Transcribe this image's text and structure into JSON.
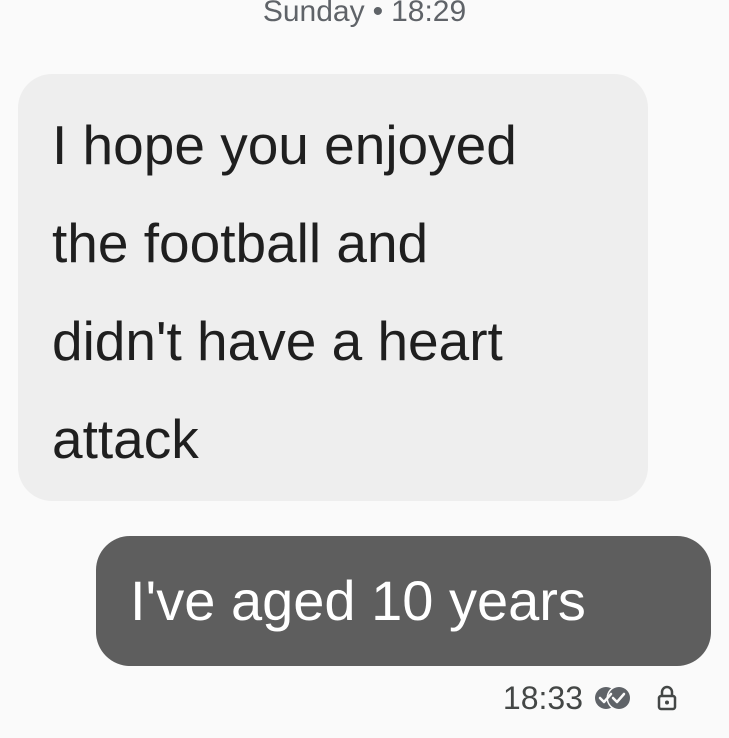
{
  "header": {
    "day": "Sunday",
    "separator": "•",
    "time": "18:29"
  },
  "messages": [
    {
      "direction": "incoming",
      "text": "I hope you enjoyed\nthe football and\ndidn't have a heart\nattack"
    },
    {
      "direction": "outgoing",
      "text": "I've aged 10 years"
    }
  ],
  "status": {
    "time": "18:33",
    "read_icon": "read-receipt-icon",
    "lock_icon": "lock-icon"
  },
  "colors": {
    "background": "#fafafa",
    "incoming_bubble": "#eeeeee",
    "outgoing_bubble": "#5e5e5e",
    "outgoing_text": "#ffffff"
  }
}
